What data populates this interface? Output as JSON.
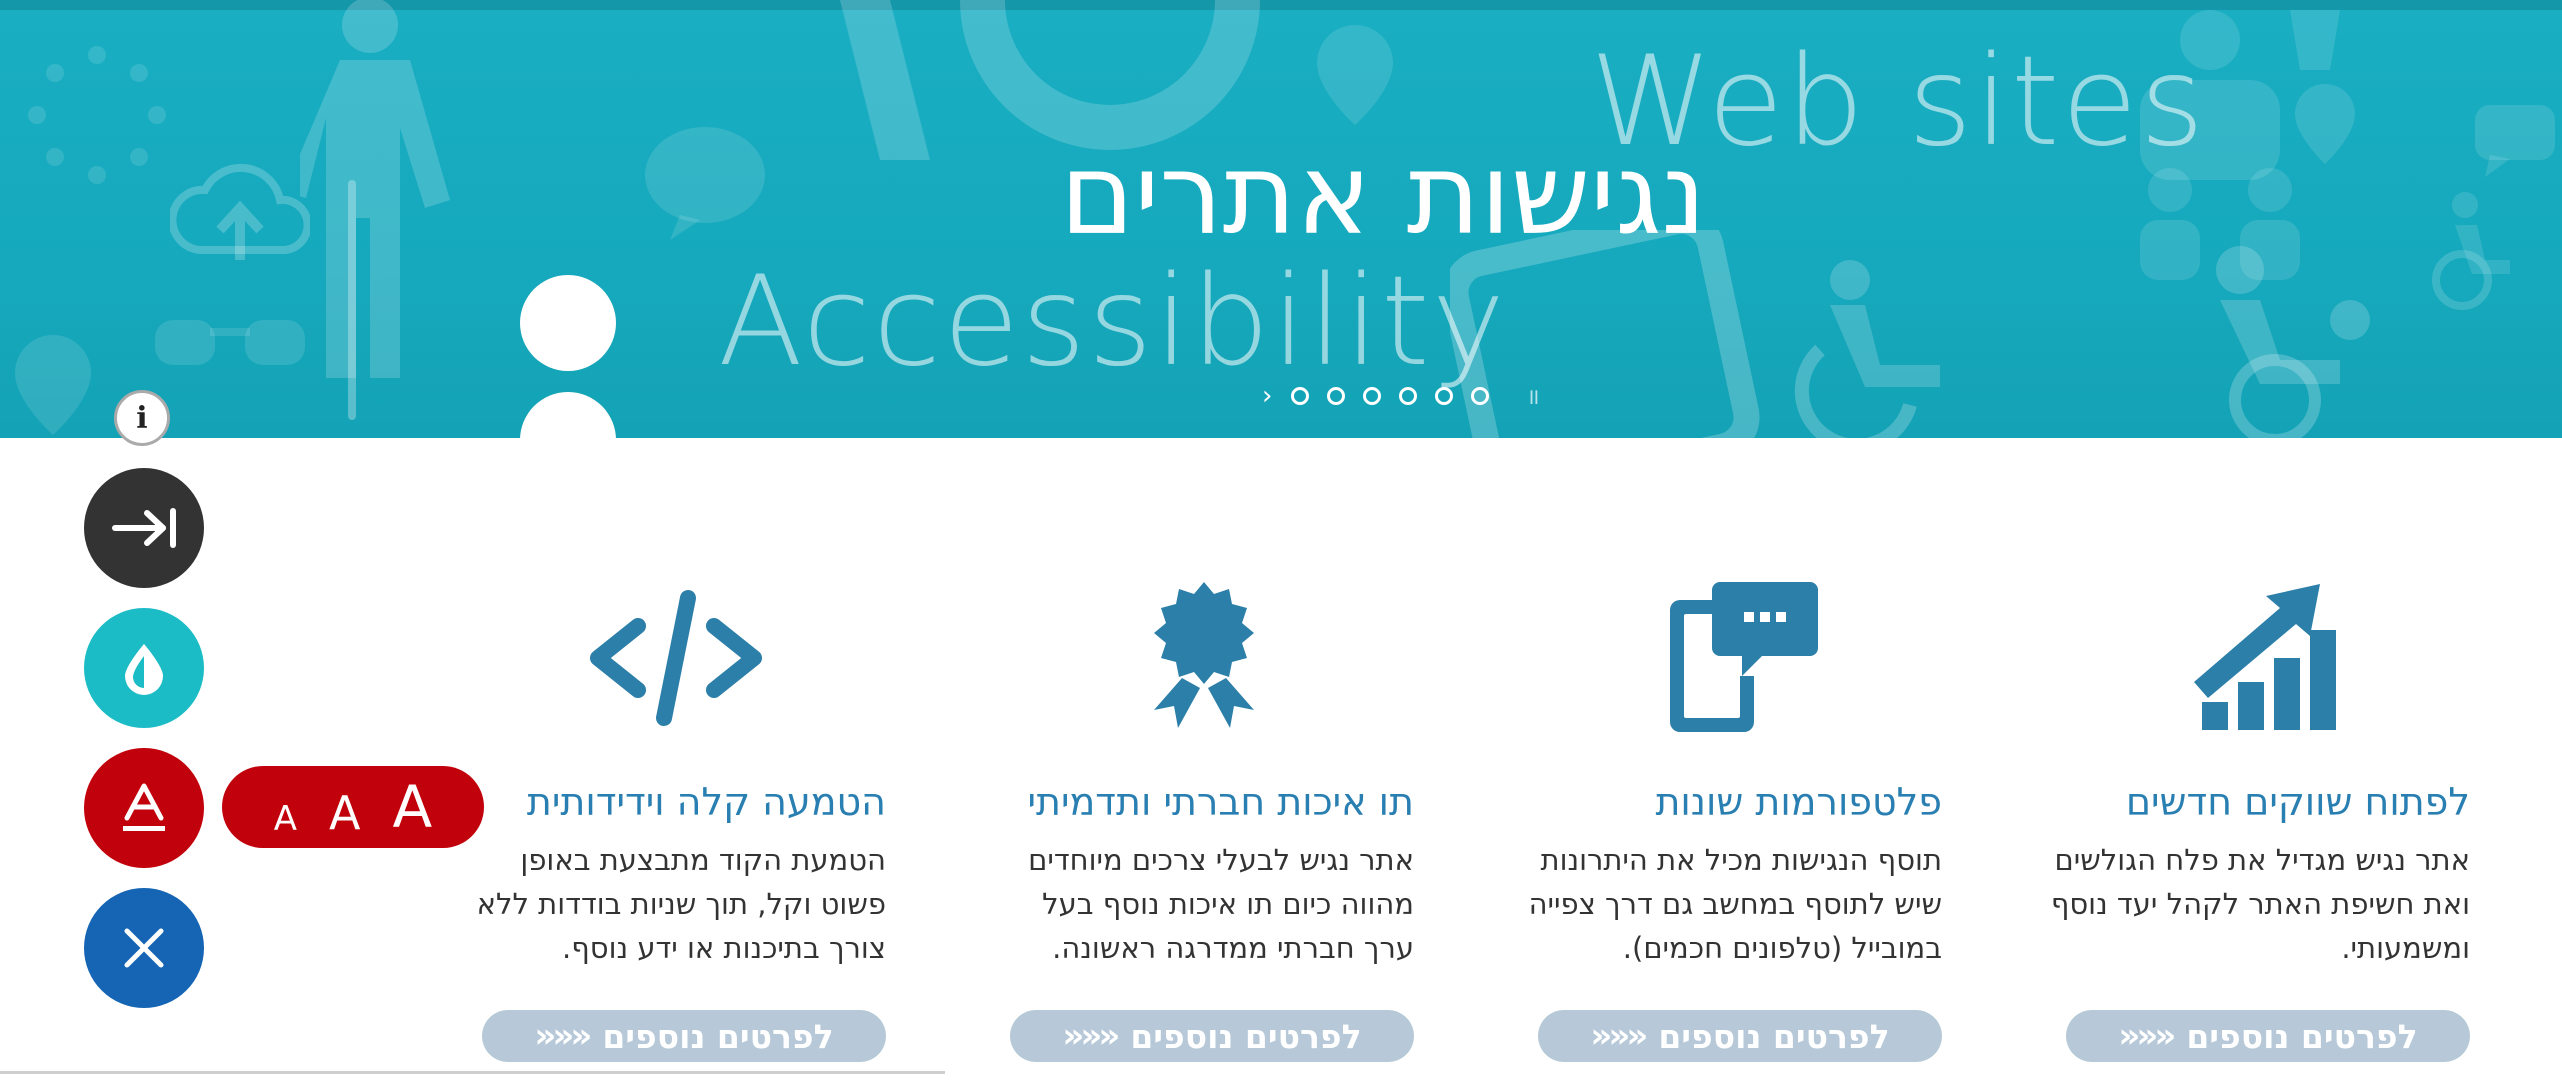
{
  "hero": {
    "title_en_top": "Web sites",
    "title_he": "נגישות אתרים",
    "title_en_bottom": "Accessibility",
    "slider_next": "›",
    "slider_pause": "॥",
    "slide_count": 6
  },
  "features": [
    {
      "icon": "bar-chart-arrow-icon",
      "title": "לפתוח שווקים חדשים",
      "text": "אתר נגיש מגדיל את פלח הגולשים ואת חשיפת האתר לקהל יעד נוסף ומשמעותי.",
      "more_label": "לפרטים נוספים",
      "more_chevrons": "«««"
    },
    {
      "icon": "phone-chat-icon",
      "title": "פלטפורמות שונות",
      "text": "תוסף הנגישות מכיל את היתרונות שיש לתוסף במחשב גם דרך צפייה במובייל (טלפונים חכמים).",
      "more_label": "לפרטים נוספים",
      "more_chevrons": "«««"
    },
    {
      "icon": "award-badge-icon",
      "title": "תו איכות חברתי ותדמיתי",
      "text": "אתר נגיש לבעלי צרכים מיוחדים מהווה כיום תו איכות נוסף בעל ערך חברתי ממדרגה ראשונה.",
      "more_label": "לפרטים נוספים",
      "more_chevrons": "«««"
    },
    {
      "icon": "code-icon",
      "title": "הטמעה קלה וידידותית",
      "text": "הטמעת הקוד מתבצעת באופן פשוט וקל, תוך שניות בודדות ללא צורך בתיכנות או ידע נוסף.",
      "more_label": "לפרטים נוספים",
      "more_chevrons": "«««"
    }
  ],
  "toolbar": {
    "info_label": "i",
    "font_small": "A",
    "font_medium": "A",
    "font_large": "A"
  },
  "colors": {
    "hero_bg": "#16a9bd",
    "feature_title": "#2a7fb2",
    "icon_blue": "#2c7fa8",
    "more_button": "#b7c9d8",
    "skip_button": "#333333",
    "contrast_button": "#1cbcc6",
    "font_button": "#c1010b",
    "close_button": "#1565b4"
  }
}
